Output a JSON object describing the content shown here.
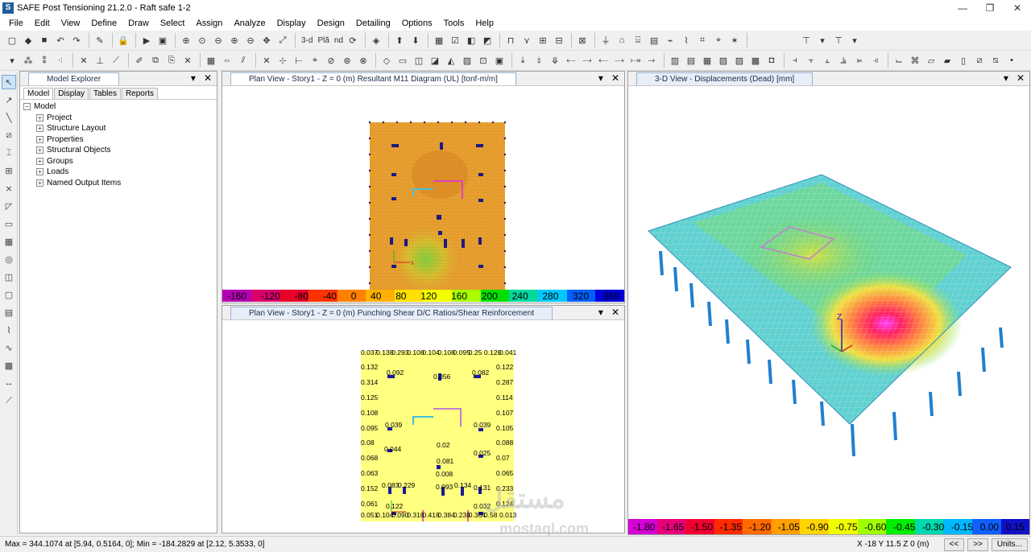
{
  "window": {
    "title": "SAFE Post Tensioning 21.2.0 - Raft safe 1-2",
    "app_icon_letter": "S",
    "minimize": "—",
    "maximize": "❐",
    "close": "✕"
  },
  "menu": [
    "File",
    "Edit",
    "View",
    "Define",
    "Draw",
    "Select",
    "Assign",
    "Analyze",
    "Display",
    "Design",
    "Detailing",
    "Options",
    "Tools",
    "Help"
  ],
  "toolbar1": {
    "text_3d": "3-d",
    "text_pln": "Plă",
    "text_nd": "nd"
  },
  "explorer": {
    "title": "Model Explorer",
    "tabs": [
      "Model",
      "Display",
      "Tables",
      "Reports"
    ],
    "root": "Model",
    "items": [
      "Project",
      "Structure Layout",
      "Properties",
      "Structural Objects",
      "Groups",
      "Loads",
      "Named Output Items"
    ],
    "toggle": "+",
    "root_toggle": "−"
  },
  "views": {
    "top": {
      "title": "Plan View - Story1 - Z = 0 (m)    Resultant M11 Diagram    (UL)  [tonf-m/m]",
      "colorbar_labels": [
        "-160",
        "-120",
        "-80",
        "-40",
        "0",
        "40",
        "80",
        "120",
        "160",
        "200",
        "240",
        "280",
        "320",
        "360"
      ],
      "colorbar_colors": [
        "#b400b4",
        "#d9006e",
        "#e8002a",
        "#ff3300",
        "#ff8000",
        "#ffb000",
        "#ffe000",
        "#f2ff00",
        "#a8ff00",
        "#00e000",
        "#00d8a0",
        "#00c8ff",
        "#0060ff",
        "#0000d8"
      ]
    },
    "bottom": {
      "title": "Plan View - Story1 - Z = 0 (m)   Punching Shear D/C Ratios/Shear Reinforcement",
      "top_row": [
        "0.037",
        "0.138",
        "0.293",
        "0.108",
        "0.104",
        "0.108",
        "0.095",
        "0.25",
        "0.128",
        "0.041"
      ],
      "bottom_row": [
        "0.051",
        "0.104",
        "0.090",
        "0.318",
        "0.418",
        "0.384",
        "0.238",
        "0.364",
        "0.58",
        "0.013"
      ],
      "left_col": [
        "0.132",
        "0.314",
        "0.125",
        "0.108",
        "0.095",
        "0.08",
        "0.068",
        "0.063",
        "0.152",
        "0.061"
      ],
      "right_col": [
        "0.122",
        "0.287",
        "0.114",
        "0.107",
        "0.105",
        "0.088",
        "0.07",
        "0.065",
        "0.233",
        "0.124"
      ],
      "interior": [
        "0.092",
        "0.056",
        "0.082",
        "0.039",
        "0.039",
        "0.02",
        "0.044",
        "0.025",
        "0.081",
        "0.008",
        "0.083",
        "0.229",
        "0.093",
        "0.134",
        "0.131",
        "0.122",
        "0.032"
      ]
    },
    "right": {
      "title": "3-D View   - Displacements (Dead)  [mm]",
      "colorbar_labels": [
        "-1.80",
        "-1.65",
        "-1.50",
        "-1.35",
        "-1.20",
        "-1.05",
        "-0.90",
        "-0.75",
        "-0.60",
        "-0.45",
        "-0.30",
        "-0.15",
        "0.00",
        "0.15"
      ],
      "colorbar_colors": [
        "#d400d4",
        "#e8007a",
        "#f00030",
        "#ff2a00",
        "#ff6a00",
        "#ffa000",
        "#ffd400",
        "#f0ff00",
        "#a0ff00",
        "#00ee00",
        "#00d8b0",
        "#00b8ff",
        "#1060ff",
        "#1010c8"
      ],
      "axis_label": "Z"
    }
  },
  "status": {
    "minmax": "Max = 344.1074 at [5.94, 0.5164, 0];  Min = -184.2829 at [2.12, 5.3533, 0]",
    "coords": "X -18  Y 11.5  Z 0 (m)",
    "prev": "<<",
    "next": ">>",
    "units": "Units..."
  },
  "watermark": {
    "text": "مستقل",
    "sub": "mostaql.com"
  },
  "colors": {
    "accent": "#1f5f99",
    "contour_base": "#e8a030",
    "shear_yellow": "#ffff80"
  }
}
